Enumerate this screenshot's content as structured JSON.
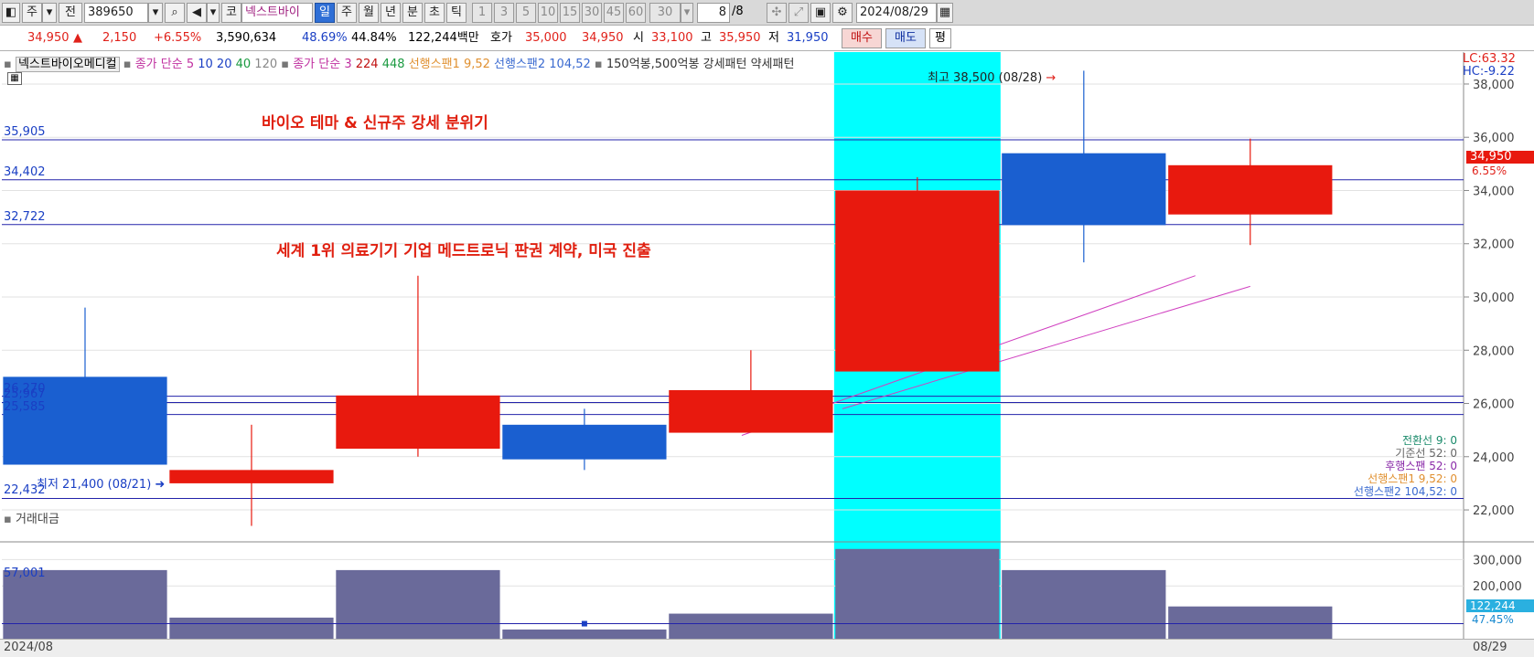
{
  "toolbar": {
    "mode_main": "주",
    "mode_prev": "전",
    "code": "389650",
    "market": "코",
    "name": "넥스트바이",
    "periods": [
      "일",
      "주",
      "월",
      "년",
      "분",
      "초",
      "틱"
    ],
    "intervals": [
      "1",
      "3",
      "5",
      "10",
      "15",
      "30",
      "45",
      "60",
      "30"
    ],
    "page_current": "8",
    "page_total": "/8",
    "date": "2024/08/29"
  },
  "quote": {
    "price": "34,950",
    "change": "2,150",
    "change_pct": "+6.55%",
    "volume": "3,590,634",
    "ratio1": "48.69%",
    "ratio2": "44.84%",
    "amount": "122,244백만",
    "bid_label": "호가",
    "ask": "35,000",
    "bid": "34,950",
    "open_label": "시",
    "open": "33,100",
    "high_label": "고",
    "high": "35,950",
    "low_label": "저",
    "low": "31,950",
    "buy_label": "매수",
    "sell_label": "매도",
    "eval_label": "평"
  },
  "legend": {
    "name": "넥스트바이오메디컬",
    "ma_label": "종가 단순",
    "ma_periods": [
      "5",
      "10",
      "20",
      "40",
      "120"
    ],
    "ma2_label": "종가 단순",
    "ma2_periods": [
      "3",
      "224",
      "448"
    ],
    "span1": "선행스팬1 9,52",
    "span2": "선행스팬2 104,52",
    "pattern": "150억봉,500억봉 강세패턴",
    "pattern2": "약세패턴"
  },
  "annotations": {
    "headline1": "바이오 테마 & 신규주 강세 분위기",
    "headline2": "세계 1위 의료기기 기업 메드트로닉 판권 계약, 미국 진출",
    "high_marker": "최고 38,500 (08/28)",
    "low_marker": "최저 21,400 (08/21)",
    "lc": "LC:63.32",
    "hc": "HC:-9.22",
    "last_price_tag": "34,950",
    "last_pct_tag": "6.55%"
  },
  "level_labels": [
    {
      "value": 35905,
      "label": "35,905"
    },
    {
      "value": 34402,
      "label": "34,402"
    },
    {
      "value": 32722,
      "label": "32,722"
    },
    {
      "value": 26270,
      "label": "26,270"
    },
    {
      "value": 26037,
      "label": "25,967"
    },
    {
      "value": 25585,
      "label": "25,585"
    },
    {
      "value": 22432,
      "label": "22,432"
    }
  ],
  "ichimoku_legend": [
    {
      "text": "전환선 9: 0",
      "color": "#1a8a6a"
    },
    {
      "text": "기준선 52: 0",
      "color": "#666666"
    },
    {
      "text": "후행스팬 52: 0",
      "color": "#8a2aa8"
    },
    {
      "text": "선행스팬1 9,52: 0",
      "color": "#e09030"
    },
    {
      "text": "선행스팬2 104,52: 0",
      "color": "#3a6ad0"
    }
  ],
  "volume_panel": {
    "title": "거래대금",
    "ref_label": "57,001",
    "last_tag": "122,244",
    "last_pct": "47.45%"
  },
  "footer": {
    "left": "2024/08",
    "right": "08/29"
  },
  "colors": {
    "up": "#e8190e",
    "down": "#1a5fd0",
    "highlight": "#00ffff",
    "volume": "#6a6a9a",
    "level_line": "#2222aa",
    "trend": "#d040c0"
  },
  "chart_data": {
    "type": "candlestick",
    "y_ticks": [
      22000,
      24000,
      26000,
      28000,
      30000,
      32000,
      34000,
      36000,
      38000
    ],
    "y_tick_labels": [
      "22,000",
      "24,000",
      "26,000",
      "28,000",
      "30,000",
      "32,000",
      "34,000",
      "36,000",
      "38,000"
    ],
    "ylim": [
      20800,
      39200
    ],
    "candles": [
      {
        "open": 27000,
        "high": 29600,
        "low": 23700,
        "close": 23700,
        "direction": "down"
      },
      {
        "open": 23000,
        "high": 25200,
        "low": 21400,
        "close": 23500,
        "direction": "up"
      },
      {
        "open": 24300,
        "high": 30800,
        "low": 24000,
        "close": 26300,
        "direction": "up"
      },
      {
        "open": 25200,
        "high": 25800,
        "low": 23500,
        "close": 23900,
        "direction": "down"
      },
      {
        "open": 24900,
        "high": 28000,
        "low": 24900,
        "close": 26500,
        "direction": "up"
      },
      {
        "open": 27200,
        "high": 34500,
        "low": 27200,
        "close": 34000,
        "direction": "up"
      },
      {
        "open": 35400,
        "high": 38500,
        "low": 31300,
        "close": 32700,
        "direction": "down"
      },
      {
        "open": 33100,
        "high": 35950,
        "low": 31950,
        "close": 34950,
        "direction": "up"
      }
    ],
    "highlight_index": 5,
    "volume_ticks": [
      200000,
      300000
    ],
    "volume_tick_labels": [
      "200,000",
      "300,000"
    ],
    "volume_ylim": [
      0,
      360000
    ],
    "volume": [
      260000,
      80000,
      260000,
      35000,
      95000,
      340000,
      260000,
      122244
    ],
    "volume_ref": 57001
  }
}
